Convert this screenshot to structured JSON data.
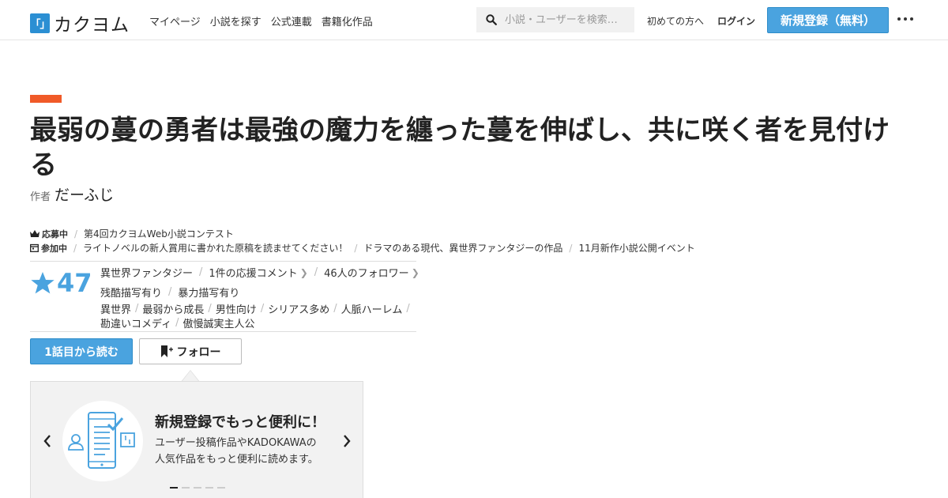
{
  "header": {
    "logo_mark": "「」",
    "logo_text": "カクヨム",
    "nav": [
      "マイページ",
      "小説を探す",
      "公式連載",
      "書籍化作品"
    ],
    "search_placeholder": "小説・ユーザーを検索…",
    "first_time": "初めての方へ",
    "login": "ログイン",
    "signup": "新規登録（無料）"
  },
  "work": {
    "title": "最弱の蔓の勇者は最強の魔力を纏った蔓を伸ばし、共に咲く者を見付ける",
    "author_label": "作者",
    "author_name": "だーふじ",
    "contest": {
      "label": "応募中",
      "items": [
        "第4回カクヨムWeb小説コンテスト"
      ]
    },
    "participation": {
      "label": "参加中",
      "items": [
        "ライトノベルの新人賞用に書かれた原稿を読ませてください！",
        "ドラマのある現代、異世界ファンタジーの作品",
        "11月新作小説公開イベント"
      ]
    },
    "stars": "47",
    "genre": "異世界ファンタジー",
    "comments": "1件の応援コメント",
    "followers": "46人のフォロワー",
    "warnings": [
      "残酷描写有り",
      "暴力描写有り"
    ],
    "tags": [
      "異世界",
      "最弱から成長",
      "男性向け",
      "シリアス多め",
      "人脈ハーレム",
      "勘違いコメディ",
      "傲慢誠実主人公"
    ],
    "read_button": "1話目から読む",
    "follow_button": "フォロー"
  },
  "promo": {
    "title": "新規登録でもっと便利に！",
    "line1": "ユーザー投稿作品やKADOKAWAの",
    "line2": "人気作品をもっと便利に読めます。",
    "slide_count": 5,
    "active_slide": 1
  },
  "colors": {
    "accent_blue": "#4aa3df",
    "accent_orange": "#f05a28"
  }
}
